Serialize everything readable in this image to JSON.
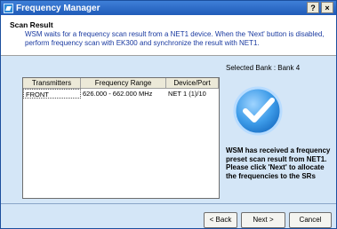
{
  "window": {
    "title": "Frequency Manager",
    "help_label": "?",
    "close_label": "×"
  },
  "header": {
    "title": "Scan Result",
    "description": "WSM waits for a frequency scan result from a NET1 device. When the 'Next' button is disabled, perform frequency scan with EK300 and synchronize the result with NET1."
  },
  "bank": {
    "label": "Selected Bank : Bank 4"
  },
  "table": {
    "columns": [
      "Transmitters",
      "Frequency Range",
      "Device/Port"
    ],
    "rows": [
      {
        "transmitter": "FRONT",
        "range": "626.000 - 662.000 MHz",
        "device": "NET 1 (1)/10"
      }
    ]
  },
  "status": {
    "message": "WSM has received a frequency preset scan result from NET1. Please click 'Next' to allocate the frequencies to the SRs"
  },
  "buttons": {
    "back": "< Back",
    "next": "Next >",
    "cancel": "Cancel"
  },
  "colors": {
    "titlebar": "#1f5bb8",
    "body_background": "#d4e6f7",
    "description_text": "#1a3aa0"
  }
}
